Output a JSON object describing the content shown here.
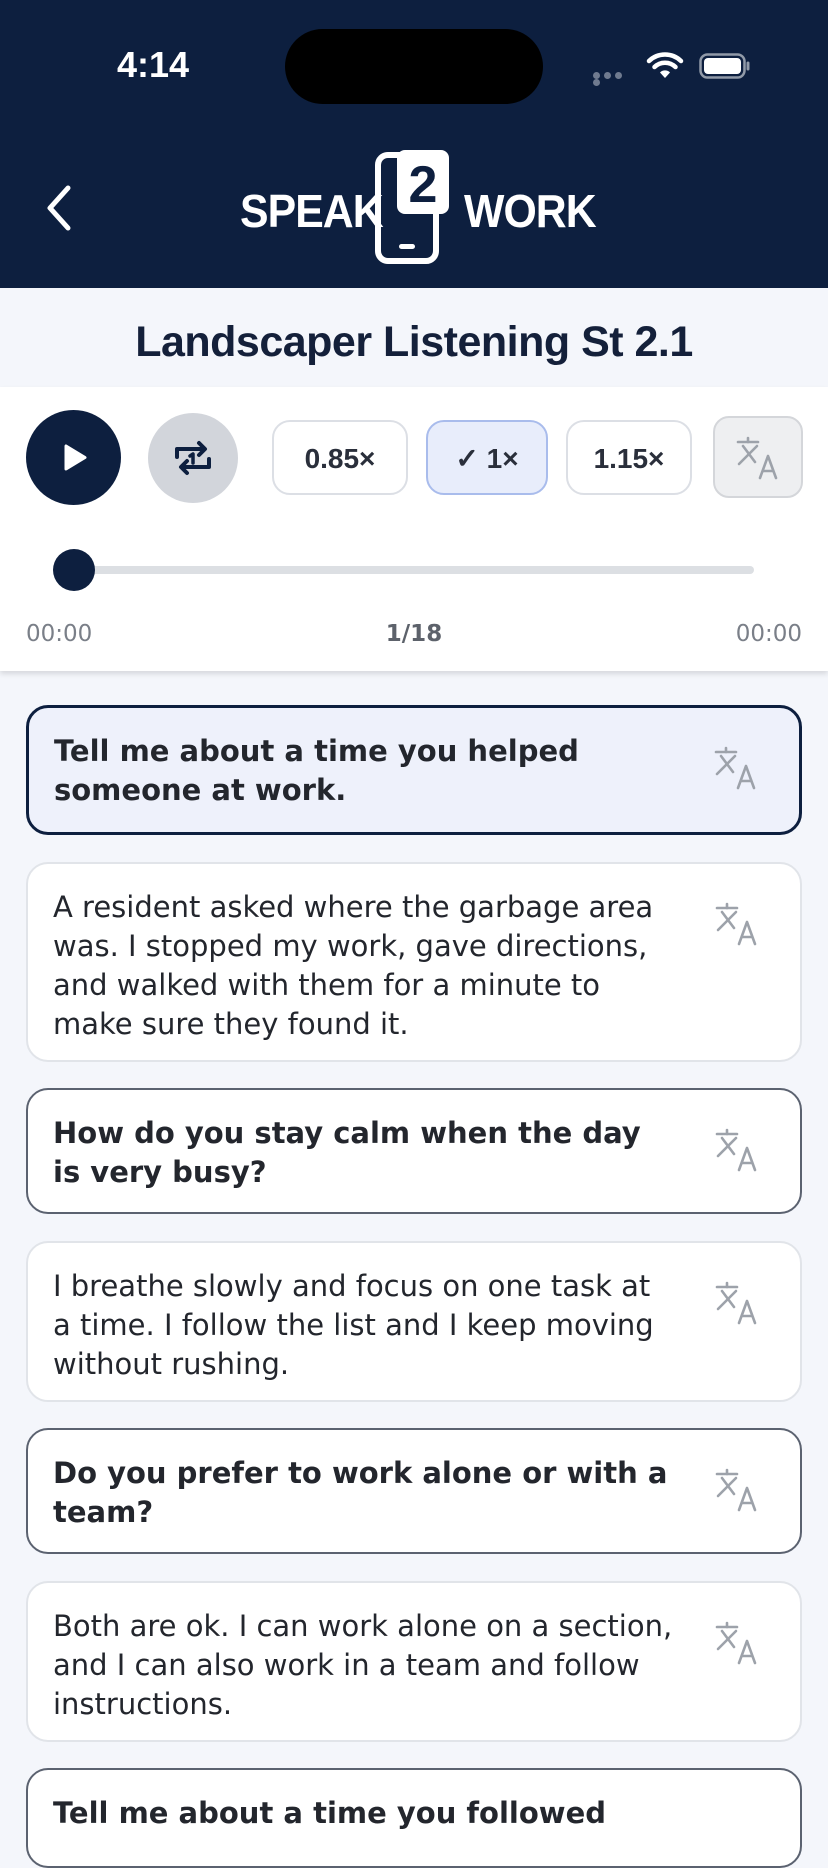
{
  "status_bar": {
    "time": "4:14"
  },
  "header": {
    "logo": {
      "left": "SPEAK",
      "digit": "2",
      "right": "WORK"
    }
  },
  "page": {
    "title": "Landscaper Listening St 2.1"
  },
  "player": {
    "speeds": [
      {
        "label": "0.85×",
        "selected": false
      },
      {
        "label": "1×",
        "check": "✓",
        "selected": true
      },
      {
        "label": "1.15×",
        "selected": false
      }
    ],
    "progress": 0,
    "time_elapsed": "00:00",
    "counter": "1/18",
    "time_total": "00:00"
  },
  "cards": [
    {
      "type": "question",
      "text": "Tell me about a time you helped someone at work."
    },
    {
      "type": "answer",
      "text": "A resident asked where the garbage area was. I stopped my work, gave directions, and walked with them for a minute to make sure they found it."
    },
    {
      "type": "question",
      "text": "How do you stay calm when the day is very busy?"
    },
    {
      "type": "answer",
      "text": "I breathe slowly and focus on one task at a time. I follow the list and I keep moving without rushing."
    },
    {
      "type": "question",
      "text": "Do you prefer to work alone or with a team?"
    },
    {
      "type": "answer",
      "text": "Both are ok. I can work alone on a section, and I can also work in a team and follow instructions."
    },
    {
      "type": "question",
      "text": "Tell me about a time you followed"
    }
  ],
  "icons": {
    "back": "chevron-left-icon",
    "play": "play-icon",
    "repeat": "repeat-one-icon",
    "translate": "translate-icon"
  },
  "colors": {
    "navy": "#0d1f3f",
    "selected_speed_bg": "#e8edfb",
    "current_card_bg": "#eef1fb"
  }
}
